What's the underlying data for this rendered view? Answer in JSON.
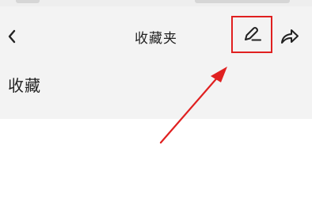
{
  "nav": {
    "title": "收藏夹"
  },
  "main": {
    "heading": "收藏"
  },
  "icons": {
    "back": "back-arrow-icon",
    "edit": "pencil-icon",
    "share": "share-arrow-icon"
  },
  "colors": {
    "annotation": "#e02020",
    "header_bg": "#f3f3f3"
  }
}
